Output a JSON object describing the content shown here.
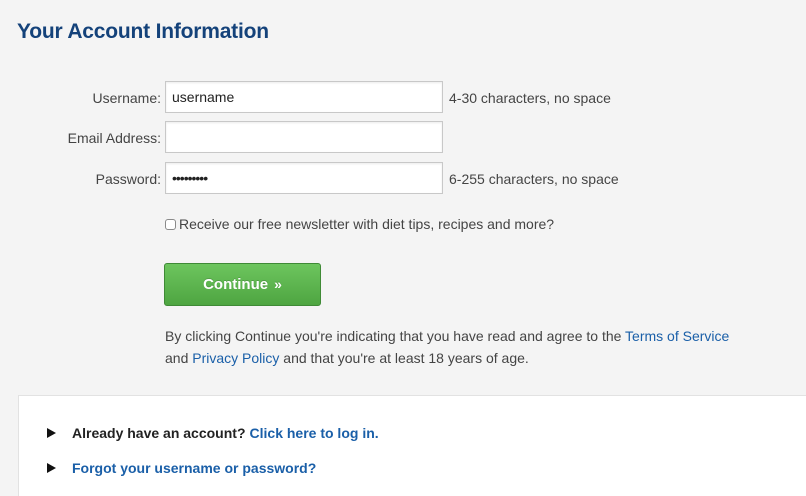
{
  "page": {
    "title": "Your Account Information"
  },
  "form": {
    "username": {
      "label": "Username:",
      "value": "username",
      "hint": "4-30 characters, no space"
    },
    "email": {
      "label": "Email Address:",
      "value": ""
    },
    "password": {
      "label": "Password:",
      "value": "•••••••••",
      "hint": "6-255 characters, no space"
    },
    "newsletter": {
      "label": "Receive our free newsletter with diet tips, recipes and more?",
      "checked": false
    },
    "continue_label": "Continue",
    "continue_arrows": "»"
  },
  "terms": {
    "part1": "By clicking Continue you're indicating that you have read and agree to the ",
    "terms_link": "Terms of Service",
    "part2": "and ",
    "privacy_link": "Privacy Policy",
    "part3": " and that you're at least 18 years of age."
  },
  "links": {
    "login_prompt": "Already have an account?",
    "login_link": "Click here to log in.",
    "forgot_link": "Forgot your username or password?"
  },
  "colors": {
    "title": "#14427a",
    "link": "#1a5fa8",
    "button": "#5cb54e"
  }
}
